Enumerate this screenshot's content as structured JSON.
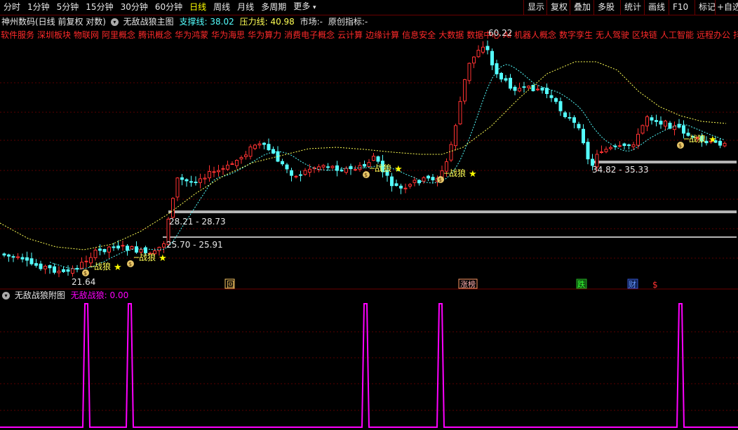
{
  "tabs": [
    "分时",
    "1分钟",
    "5分钟",
    "15分钟",
    "30分钟",
    "60分钟",
    "日线",
    "周线",
    "月线",
    "多周期",
    "更多"
  ],
  "active_tab": "日线",
  "right_buttons": [
    "显示",
    "复权",
    "叠加",
    "多股",
    "统计",
    "画线",
    "F10",
    "标记",
    "+自选"
  ],
  "info": {
    "stock": "神州数码(日线 前复权 对数)",
    "indicator": "无敌战狼主图",
    "support_label": "支撑线:",
    "support_value": "38.02",
    "pressure_label": "压力线:",
    "pressure_value": "40.98",
    "market": "市场:-",
    "original": "原创指标:-"
  },
  "concepts": [
    "软件服务",
    "深圳板块",
    "物联网",
    "阿里概念",
    "腾讯概念",
    "华为鸿蒙",
    "华为海思",
    "华为算力",
    "消费电子概念",
    "云计算",
    "边缘计算",
    "信息安全",
    "大数据",
    "数据中心",
    "AI",
    "机器人概念",
    "数字孪生",
    "无人驾驶",
    "区块链",
    "人工智能",
    "远程办公",
    "抖音"
  ],
  "chart_labels": {
    "high": "60.22",
    "low": "21.64",
    "zone1": "28.21 - 28.73",
    "zone2": "25.70 - 25.91",
    "zone3": "34.82 - 35.33",
    "signal": "战狼"
  },
  "markers": {
    "hui": "回",
    "zhangbang": "涨榜",
    "die": "跌",
    "cai": "财",
    "dollar": "$"
  },
  "sub_chart": {
    "title": "无敌战狼附图",
    "label": "无敌战狼:",
    "value": "0.00"
  },
  "colors": {
    "up": "#ff3232",
    "down": "#54ffff",
    "ma": "#ffff54",
    "accent": "#ff00ff"
  },
  "chart_data": {
    "type": "candlestick",
    "y_scale": "log",
    "signals_index": [
      18,
      28,
      82,
      98,
      149
    ]
  }
}
